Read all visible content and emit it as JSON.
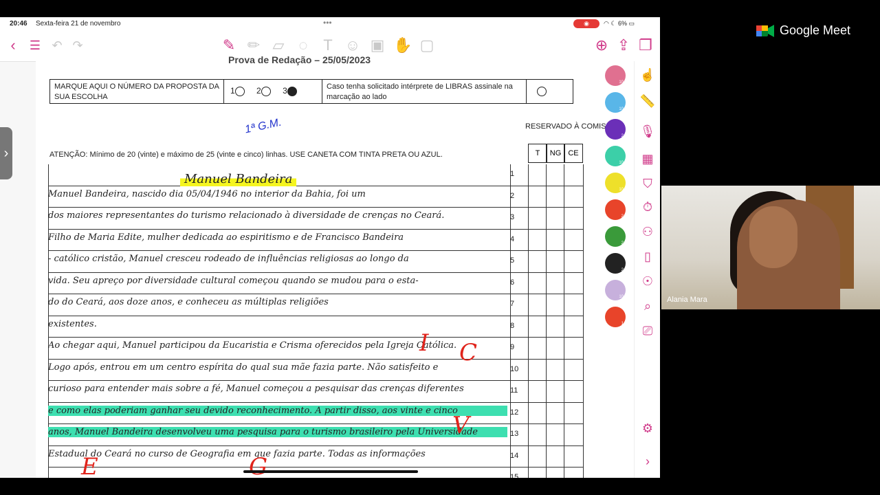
{
  "status": {
    "time": "20:46",
    "date": "Sexta-feira 21 de novembro",
    "dots": "•••",
    "battery": "6%"
  },
  "doc": {
    "header": "Prova de Redação – 25/05/2023",
    "box": {
      "marque": "MARQUE AQUI O NÚMERO DA PROPOSTA DA SUA ESCOLHA",
      "opt1": "1",
      "opt2": "2",
      "opt3": "3",
      "libras": "Caso tenha solicitado intérprete de LIBRAS assinale na marcação ao lado"
    },
    "annotation": "1ª G.M.",
    "atencao": "ATENÇÃO: Mínimo de 20 (vinte) e máximo de 25 (vinte e cinco) linhas. USE CANETA COM TINTA PRETA OU AZUL.",
    "reservado": "RESERVADO À COMISSÃO",
    "cols": [
      "T",
      "NG",
      "CE"
    ],
    "title": "Manuel Bandeira",
    "lines": [
      {
        "n": "1",
        "text": ""
      },
      {
        "n": "2",
        "text": "Manuel Bandeira, nascido dia 05/04/1946 no interior da Bahia, foi um"
      },
      {
        "n": "3",
        "text": "dos maiores representantes do turismo relacionado à diversidade de crenças no Ceará."
      },
      {
        "n": "4",
        "text": "Filho de Maria Edite, mulher dedicada ao espiritismo e de Francisco Bandeira"
      },
      {
        "n": "5",
        "text": "- católico cristão, Manuel cresceu rodeado de influências religiosas ao longo da"
      },
      {
        "n": "6",
        "text": "vida. Seu apreço por diversidade cultural começou quando se mudou para o esta-"
      },
      {
        "n": "7",
        "text": "do do Ceará, aos doze anos, e conheceu as múltiplas religiões"
      },
      {
        "n": "8",
        "text": "existentes."
      },
      {
        "n": "9",
        "text": "Ao chegar aqui, Manuel participou da Eucaristia e Crisma oferecidos pela Igreja Católica."
      },
      {
        "n": "10",
        "text": "Logo após, entrou em um centro espírita do qual sua mãe fazia parte. Não satisfeito e"
      },
      {
        "n": "11",
        "text": "curioso para entender mais sobre a fé, Manuel começou a pesquisar das crenças diferentes"
      },
      {
        "n": "12",
        "text": "e como elas poderiam ganhar seu devido reconhecimento. A partir disso, aos vinte e cinco"
      },
      {
        "n": "13",
        "text": "anos, Manuel Bandeira desenvolveu uma pesquisa para o turismo brasileiro pela Universidade"
      },
      {
        "n": "14",
        "text": "Estadual do Ceará no curso de Geografia em que fazia parte. Todas as informações"
      },
      {
        "n": "15",
        "text": ""
      }
    ]
  },
  "meet": {
    "brand": "Google Meet",
    "participant": "Alania Mara"
  },
  "pens": [
    "#e07090",
    "#59b6e8",
    "#6b2fb8",
    "#3ccfa8",
    "#eee02a",
    "#e8442a",
    "#3a9a3a",
    "#222222",
    "#c7b0dc",
    "#e8442a"
  ],
  "pen_labels": [
    "10",
    "10",
    "2",
    "10",
    "10",
    "2",
    "2",
    "2",
    "10",
    "1"
  ]
}
